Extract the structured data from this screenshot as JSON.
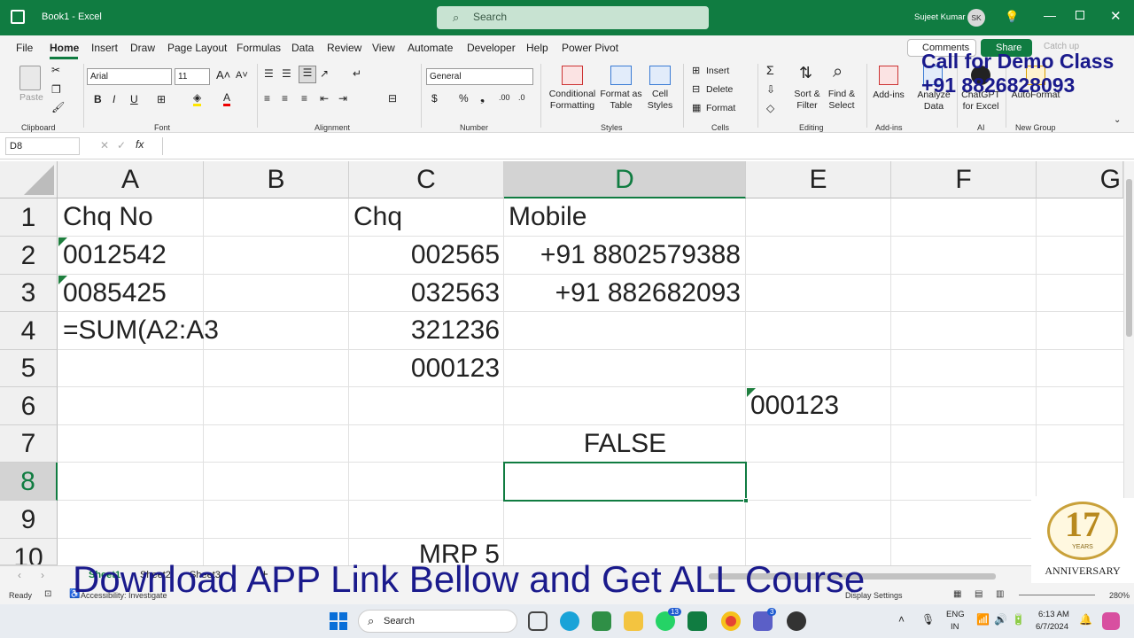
{
  "titlebar": {
    "doc_title": "Book1  -  Excel",
    "search_placeholder": "Search",
    "user_name": "Sujeet Kumar",
    "user_initials": "SK"
  },
  "menu": {
    "tabs": [
      "File",
      "Home",
      "Insert",
      "Draw",
      "Page Layout",
      "Formulas",
      "Data",
      "Review",
      "View",
      "Automate",
      "Developer",
      "Help",
      "Power Pivot"
    ],
    "active": "Home",
    "comments": "Comments",
    "share": "Share",
    "catchup": "Catch up"
  },
  "ribbon": {
    "clipboard": {
      "paste": "Paste",
      "label": "Clipboard"
    },
    "font": {
      "name": "Arial",
      "size": "11",
      "label": "Font"
    },
    "alignment": {
      "label": "Alignment"
    },
    "number": {
      "format": "General",
      "label": "Number"
    },
    "styles": {
      "cond": "Conditional Formatting",
      "table": "Format as Table",
      "cell": "Cell Styles",
      "label": "Styles"
    },
    "cells": {
      "insert": "Insert",
      "delete": "Delete",
      "format": "Format",
      "label": "Cells"
    },
    "editing": {
      "sort": "Sort & Filter",
      "find": "Find & Select",
      "label": "Editing"
    },
    "addins": {
      "addins": "Add-ins",
      "analyze": "Analyze Data",
      "label": "Add-ins"
    },
    "ai": {
      "chatgpt": "ChatGPT for Excel",
      "label": "AI"
    },
    "newgroup": {
      "autoformat": "AutoFormat",
      "label": "New Group"
    }
  },
  "formula_bar": {
    "name_box": "D8",
    "fx": "fx",
    "content": ""
  },
  "columns": [
    "A",
    "B",
    "C",
    "D",
    "E",
    "F",
    "G"
  ],
  "rows": [
    "1",
    "2",
    "3",
    "4",
    "5",
    "6",
    "7",
    "8",
    "9",
    "10"
  ],
  "cells": {
    "A1": "Chq No",
    "A2": "0012542",
    "A3": "0085425",
    "A4": "=SUM(A2:A3",
    "C1": "Chq",
    "C2": "002565",
    "C3": "032563",
    "C4": "321236",
    "C5": "000123",
    "C10": "MRP 5",
    "D1": "Mobile",
    "D2": "+91 8802579388",
    "D3": "+91 882682093",
    "D7": "FALSE",
    "E6": "000123"
  },
  "sheets": [
    "Sheet1",
    "Sheet2",
    "Sheet3"
  ],
  "status": {
    "ready": "Ready",
    "accessibility": "Accessibility: Investigate",
    "display": "Display Settings",
    "zoom": "280%"
  },
  "overlay": {
    "demo_line1": "Call for Demo Class",
    "demo_line2": "+91 8826828093",
    "banner": "Download APP Link Bellow and Get ALL Course",
    "badge_num": "17",
    "badge_years": "YEARS",
    "badge_text": "ANNIVERSARY"
  },
  "taskbar": {
    "search": "Search",
    "lang1": "ENG",
    "lang2": "IN",
    "time": "6:13 AM",
    "date": "6/7/2024",
    "whatsapp_badge": "13",
    "teams_badge": "3"
  }
}
